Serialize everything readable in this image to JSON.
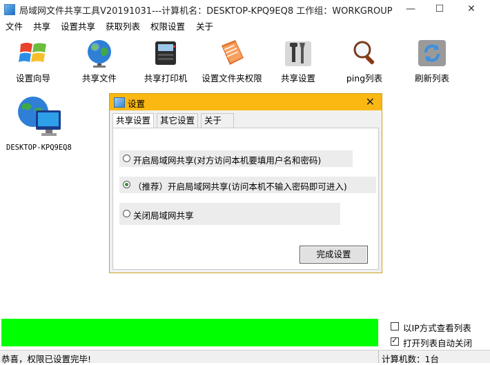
{
  "window": {
    "title": "局域网文件共享工具V20191031---计算机名：DESKTOP-KPQ9EQ8  工作组：WORKGROUP",
    "minimize_icon": "minimize-icon",
    "maximize_icon": "maximize-icon",
    "close_icon": "close-icon"
  },
  "menu": [
    "文件",
    "共享",
    "设置共享",
    "获取列表",
    "权限设置",
    "关于"
  ],
  "toolbar": [
    {
      "label": "设置向导",
      "icon": "windows-logo-icon"
    },
    {
      "label": "共享文件",
      "icon": "globe-icon"
    },
    {
      "label": "共享打印机",
      "icon": "printer-icon"
    },
    {
      "label": "设置文件夹权限",
      "icon": "folder-permission-icon"
    },
    {
      "label": "共享设置",
      "icon": "tools-icon"
    },
    {
      "label": "ping列表",
      "icon": "magnifier-icon"
    },
    {
      "label": "刷新列表",
      "icon": "refresh-icon"
    }
  ],
  "computer": {
    "name": "DESKTOP-KPQ9EQ8",
    "icon": "network-computer-icon"
  },
  "dialog": {
    "title": "设置",
    "tabs": [
      "共享设置",
      "其它设置",
      "关于"
    ],
    "active_tab": 0,
    "options": [
      {
        "label": "开启局域网共享(对方访问本机要填用户名和密码)",
        "selected": false
      },
      {
        "label": "（推荐）开启局域网共享(访问本机不输入密码即可进入)",
        "selected": true
      },
      {
        "label": "关闭局域网共享",
        "selected": false
      }
    ],
    "finish_button": "完成设置"
  },
  "progress": {
    "value": 1.0,
    "color": "#00ff00"
  },
  "checkboxes": [
    {
      "label": "以IP方式查看列表",
      "checked": false
    },
    {
      "label": "打开列表自动关闭",
      "checked": true
    }
  ],
  "status": {
    "message": "恭喜，权限已设置完毕!",
    "computer_count": "计算机数：1台"
  },
  "colors": {
    "dialog_title": "#fbb813",
    "progress": "#00ff00"
  }
}
